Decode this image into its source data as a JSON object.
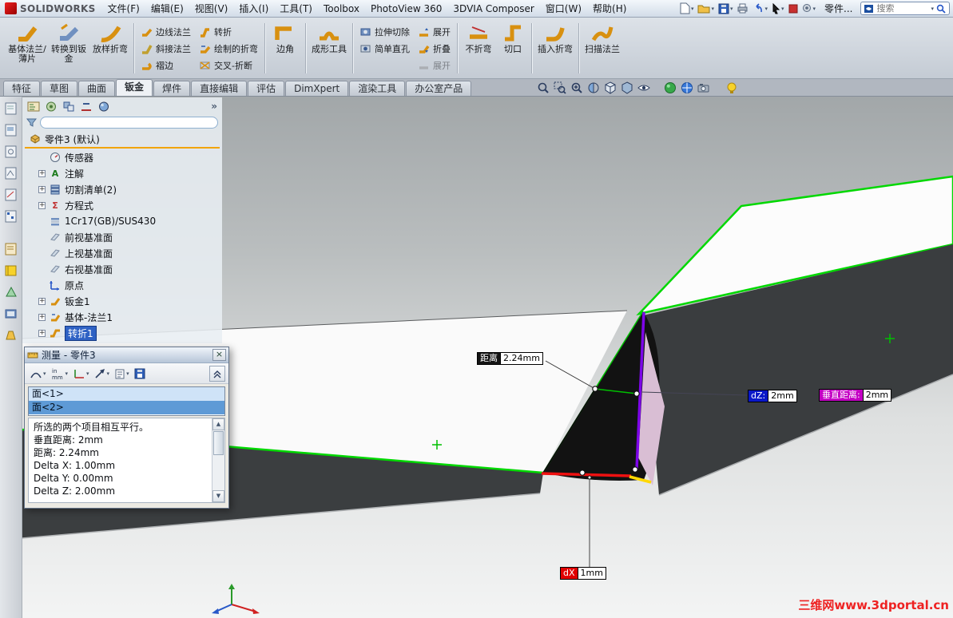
{
  "menubar": {
    "logo_text": "SOLIDWORKS",
    "menus": [
      "文件(F)",
      "编辑(E)",
      "视图(V)",
      "插入(I)",
      "工具(T)",
      "Toolbox",
      "PhotoView 360",
      "3DVIA Composer",
      "窗口(W)",
      "帮助(H)"
    ],
    "doc_label": "零件...",
    "search_placeholder": "搜索"
  },
  "ribbon": {
    "buttons": [
      {
        "label": "基体法兰/薄片"
      },
      {
        "label": "转换到钣金"
      },
      {
        "label": "放样折弯"
      },
      {
        "label": "边线法兰"
      },
      {
        "label": "斜接法兰"
      },
      {
        "label": "褶边"
      },
      {
        "label": "转折"
      },
      {
        "label": "绘制的折弯"
      },
      {
        "label": "交叉-折断"
      },
      {
        "label": "边角"
      },
      {
        "label": "成形工具"
      },
      {
        "label": "拉伸切除"
      },
      {
        "label": "简单直孔"
      },
      {
        "label": "展开"
      },
      {
        "label": "折叠"
      },
      {
        "label": "展开"
      },
      {
        "label": "不折弯"
      },
      {
        "label": "切口"
      },
      {
        "label": "插入折弯"
      },
      {
        "label": "扫描法兰"
      }
    ]
  },
  "tabs": {
    "active": "钣金",
    "items": [
      {
        "label": "特征"
      },
      {
        "label": "草图"
      },
      {
        "label": "曲面"
      },
      {
        "label": "钣金"
      },
      {
        "label": "焊件"
      },
      {
        "label": "直接编辑"
      },
      {
        "label": "评估"
      },
      {
        "label": "DimXpert"
      },
      {
        "label": "渲染工具"
      },
      {
        "label": "办公室产品"
      }
    ]
  },
  "feature_tree": {
    "root_label": "零件3 (默认)",
    "items": [
      {
        "label": "传感器"
      },
      {
        "label": "注解"
      },
      {
        "label": "切割清单(2)"
      },
      {
        "label": "方程式"
      },
      {
        "label": "1Cr17(GB)/SUS430"
      },
      {
        "label": "前视基准面"
      },
      {
        "label": "上视基准面"
      },
      {
        "label": "右视基准面"
      },
      {
        "label": "原点"
      },
      {
        "label": "钣金1"
      },
      {
        "label": "基体-法兰1"
      },
      {
        "label": "转折1"
      }
    ]
  },
  "measure_dialog": {
    "title": "测量 - 零件3",
    "selection": [
      {
        "label": "面<1>"
      },
      {
        "label": "面<2>"
      }
    ],
    "results": [
      {
        "text": "所选的两个项目相互平行。"
      },
      {
        "text": "垂直距离: 2mm"
      },
      {
        "text": "距离: 2.24mm"
      },
      {
        "text": "Delta X: 1.00mm"
      },
      {
        "text": "Delta Y: 0.00mm"
      },
      {
        "text": "Delta Z: 2.00mm"
      }
    ]
  },
  "viewport": {
    "callouts": {
      "distance_label": "距离",
      "distance_value": "2.24mm",
      "dz_label": "dZ:",
      "dz_value": "2mm",
      "normal_label": "垂直距离:",
      "normal_value": "2mm",
      "dx_label": "dX",
      "dx_value": "1mm"
    },
    "watermark": "三维网www.3dportal.cn"
  },
  "icons": {
    "expand_plus": "+",
    "dropdown_caret": "▾",
    "close": "×",
    "panel_chevron": "»",
    "scroll_up": "▲",
    "scroll_down": "▼",
    "annotation_glyph": "A",
    "equation_glyph": "Σ"
  },
  "colors": {
    "selection_green": "#00d800",
    "callout_blue": "#0a18c8",
    "callout_magenta": "#c400c4",
    "callout_red": "#e00000",
    "measure_purple": "#7d05e8",
    "measure_red_line": "#ee1111",
    "measure_yellow_line": "#ffd800",
    "tree_selection_blue": "#2f62c4",
    "rollback_orange": "#f2a400"
  }
}
